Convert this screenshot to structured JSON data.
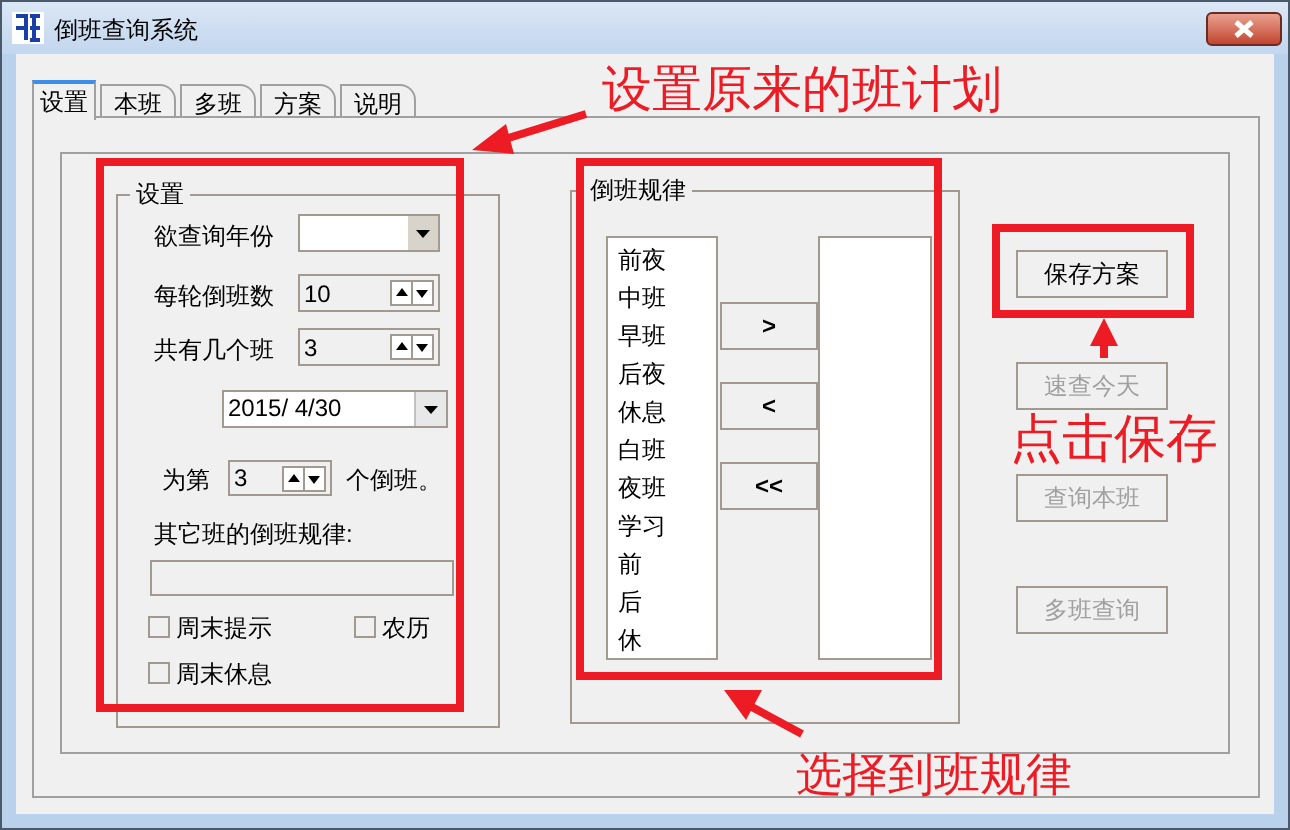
{
  "window": {
    "title": "倒班查询系统"
  },
  "tabs": [
    {
      "label": "设置",
      "selected": true
    },
    {
      "label": "本班",
      "selected": false
    },
    {
      "label": "多班",
      "selected": false
    },
    {
      "label": "方案",
      "selected": false
    },
    {
      "label": "说明",
      "selected": false
    }
  ],
  "settings_group": {
    "title": "设置",
    "fields": [
      {
        "kind": "dropdown",
        "label": "欲查询年份"
      },
      {
        "kind": "spinner",
        "label": "每轮倒班数",
        "value": "10"
      },
      {
        "kind": "spinner",
        "label": "共有几个班",
        "value": "3"
      }
    ],
    "date": {
      "value": "2015/ 4/30"
    },
    "shift_index": {
      "prefix": "为第",
      "value": "3",
      "suffix": "个倒班。"
    },
    "other_rules": {
      "label": "其它班的倒班规律:",
      "disabled": true
    },
    "checkboxes": [
      {
        "label": "周末提示",
        "checked": false
      },
      {
        "label": "农历",
        "checked": false
      },
      {
        "label": "周末休息",
        "checked": false
      }
    ]
  },
  "pattern_group": {
    "title": "倒班规律",
    "available": [
      "前夜",
      "中班",
      "早班",
      "后夜",
      "休息",
      "白班",
      "夜班",
      "学习",
      "前",
      "后",
      "休"
    ],
    "move_buttons": [
      ">",
      "<",
      "<<"
    ]
  },
  "buttons": [
    {
      "label": "保存方案",
      "disabled": false
    },
    {
      "label": "速查今天",
      "disabled": true
    },
    {
      "label": "查询本班",
      "disabled": true
    },
    {
      "label": "多班查询",
      "disabled": true
    }
  ],
  "annotations": [
    {
      "text": "设置原来的班计划"
    },
    {
      "text": "点击保存"
    },
    {
      "text": "选择到班规律"
    }
  ]
}
